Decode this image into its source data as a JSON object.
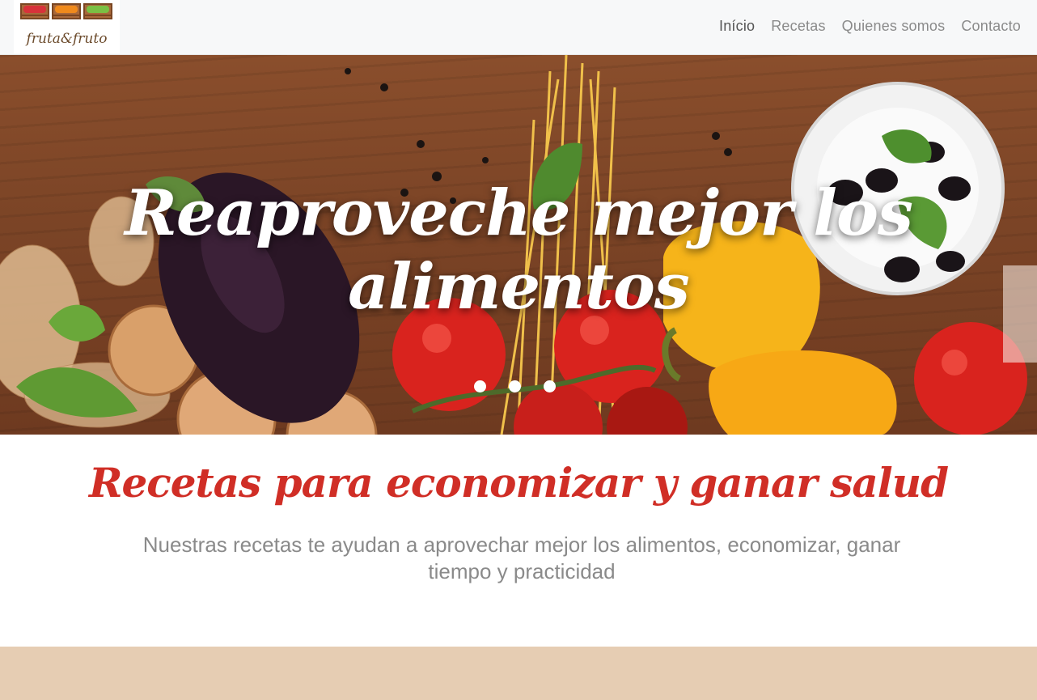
{
  "brand": {
    "name": "fruta&fruto"
  },
  "nav": {
    "items": [
      {
        "label": "Início",
        "active": true
      },
      {
        "label": "Recetas",
        "active": false
      },
      {
        "label": "Quienes somos",
        "active": false
      },
      {
        "label": "Contacto",
        "active": false
      }
    ]
  },
  "hero": {
    "title": "Reaproveche mejor los alimentos",
    "slides_count": 3
  },
  "section": {
    "title": "Recetas para economizar y ganar salud",
    "subtitle": "Nuestras recetas te ayudan a aprovechar mejor los alimentos, economizar, ganar tiempo y practicidad"
  },
  "colors": {
    "accent_red": "#d02e26",
    "beige": "#e6cdb3",
    "navbar_bg": "#f7f8f9"
  }
}
